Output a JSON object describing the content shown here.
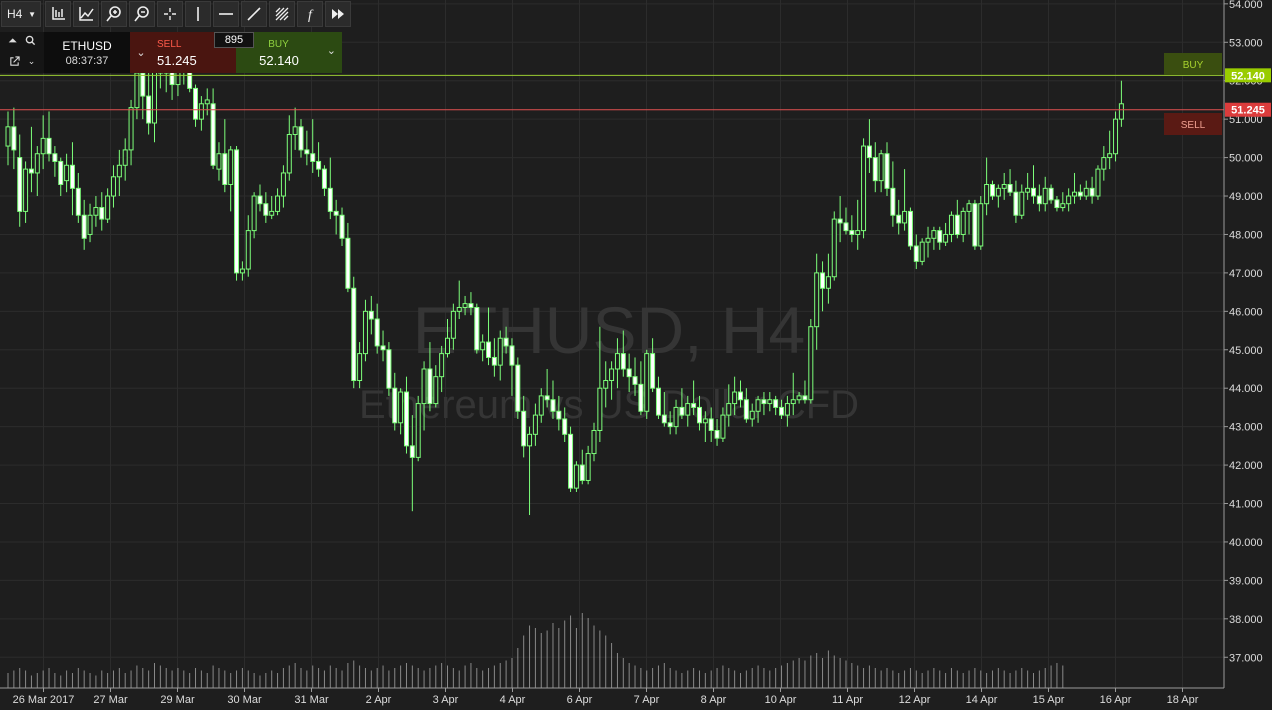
{
  "toolbar": {
    "timeframe": "H4",
    "tools": [
      "crosshair-chart-icon",
      "indicator-icon",
      "zoom-in-icon",
      "zoom-out-icon",
      "cursor-cross-icon",
      "vertical-line-icon",
      "horizontal-line-icon",
      "trend-line-icon",
      "fibonacci-icon",
      "function-icon",
      "fast-forward-icon"
    ]
  },
  "trade_panel": {
    "symbol": "ETHUSD",
    "countdown": "08:37:37",
    "sell_label": "SELL",
    "sell_price": "51.245",
    "spread": "895",
    "buy_label": "BUY",
    "buy_price": "52.140"
  },
  "colors": {
    "background": "#1e1e1e",
    "grid": "#2c2c2c",
    "candle": "#7dff7a",
    "volume": "#cfcfcf",
    "buy_line": "#9acd32",
    "sell_line": "#e05050",
    "buy_tag": "#99cc00",
    "sell_tag": "#dc3c3c"
  },
  "chart_data": {
    "type": "candlestick",
    "symbol": "ETHUSD",
    "timeframe": "H4",
    "watermark_title": "ETHUSD, H4",
    "watermark_subtitle": "Ethereum vs US Dollar CFD",
    "ylim": [
      36.2,
      54.1
    ],
    "y_ticks": [
      "54.000",
      "53.000",
      "52.000",
      "51.000",
      "50.000",
      "49.000",
      "48.000",
      "47.000",
      "46.000",
      "45.000",
      "44.000",
      "43.000",
      "42.000",
      "41.000",
      "40.000",
      "39.000",
      "38.000",
      "37.000"
    ],
    "x_labels": [
      "26 Mar 2017",
      "27 Mar",
      "29 Mar",
      "30 Mar",
      "31 Mar",
      "2 Apr",
      "3 Apr",
      "4 Apr",
      "6 Apr",
      "7 Apr",
      "8 Apr",
      "10 Apr",
      "11 Apr",
      "12 Apr",
      "14 Apr",
      "15 Apr",
      "16 Apr",
      "18 Apr"
    ],
    "buy_price": 52.14,
    "sell_price": 51.245,
    "buy_tag": "52.140",
    "sell_tag": "51.245",
    "buy_label": "BUY",
    "sell_label": "SELL",
    "candles": [
      [
        50.3,
        51.2,
        49.8,
        50.8
      ],
      [
        50.8,
        51.3,
        49.7,
        50.2
      ],
      [
        50.0,
        50.6,
        48.2,
        48.6
      ],
      [
        48.6,
        49.9,
        48.3,
        49.7
      ],
      [
        49.7,
        50.8,
        49.1,
        49.6
      ],
      [
        49.6,
        50.3,
        49.0,
        50.1
      ],
      [
        50.1,
        51.1,
        49.7,
        50.5
      ],
      [
        50.5,
        51.2,
        49.9,
        50.1
      ],
      [
        50.1,
        50.3,
        49.5,
        49.9
      ],
      [
        49.9,
        50.0,
        49.0,
        49.3
      ],
      [
        49.4,
        50.1,
        49.1,
        49.8
      ],
      [
        49.8,
        50.4,
        48.5,
        49.2
      ],
      [
        49.2,
        49.6,
        48.3,
        48.5
      ],
      [
        48.5,
        48.9,
        47.6,
        47.9
      ],
      [
        48.0,
        48.8,
        47.8,
        48.5
      ],
      [
        48.5,
        49.0,
        48.2,
        48.7
      ],
      [
        48.7,
        49.1,
        48.1,
        48.4
      ],
      [
        48.4,
        49.2,
        48.3,
        49.0
      ],
      [
        49.0,
        49.8,
        48.7,
        49.5
      ],
      [
        49.5,
        50.2,
        49.0,
        49.8
      ],
      [
        49.8,
        50.5,
        49.4,
        50.2
      ],
      [
        50.2,
        51.5,
        49.8,
        51.3
      ],
      [
        51.3,
        52.5,
        51.0,
        52.2
      ],
      [
        52.2,
        52.6,
        51.0,
        51.6
      ],
      [
        51.6,
        52.5,
        50.6,
        50.9
      ],
      [
        50.9,
        52.9,
        50.4,
        52.6
      ],
      [
        52.6,
        53.2,
        51.8,
        52.2
      ],
      [
        52.2,
        52.9,
        51.7,
        52.3
      ],
      [
        52.3,
        52.6,
        51.5,
        51.9
      ],
      [
        51.9,
        52.7,
        51.6,
        52.3
      ],
      [
        52.3,
        52.9,
        51.9,
        52.6
      ],
      [
        52.6,
        53.0,
        51.7,
        51.8
      ],
      [
        51.8,
        51.9,
        50.8,
        51.0
      ],
      [
        51.0,
        51.6,
        50.7,
        51.4
      ],
      [
        51.4,
        51.8,
        51.1,
        51.5
      ],
      [
        51.4,
        51.8,
        49.7,
        49.8
      ],
      [
        49.7,
        50.4,
        49.4,
        50.1
      ],
      [
        50.1,
        51.0,
        49.1,
        49.3
      ],
      [
        49.3,
        50.3,
        48.6,
        50.2
      ],
      [
        50.2,
        50.3,
        46.8,
        47.0
      ],
      [
        47.0,
        47.3,
        46.8,
        47.1
      ],
      [
        47.1,
        48.5,
        46.9,
        48.1
      ],
      [
        48.1,
        49.1,
        47.9,
        49.0
      ],
      [
        49.0,
        49.3,
        48.6,
        48.8
      ],
      [
        48.8,
        49.1,
        48.3,
        48.5
      ],
      [
        48.5,
        49.0,
        48.4,
        48.6
      ],
      [
        48.6,
        49.2,
        48.5,
        49.0
      ],
      [
        49.0,
        49.8,
        48.7,
        49.6
      ],
      [
        49.6,
        51.1,
        49.4,
        50.6
      ],
      [
        50.6,
        51.3,
        50.2,
        50.8
      ],
      [
        50.8,
        51.0,
        50.0,
        50.2
      ],
      [
        50.2,
        50.7,
        49.8,
        50.1
      ],
      [
        50.1,
        51.0,
        49.6,
        49.9
      ],
      [
        49.9,
        50.4,
        49.5,
        49.7
      ],
      [
        49.7,
        49.8,
        49.0,
        49.2
      ],
      [
        49.2,
        50.0,
        48.4,
        48.6
      ],
      [
        48.6,
        48.9,
        48.0,
        48.5
      ],
      [
        48.5,
        48.7,
        47.7,
        47.9
      ],
      [
        47.9,
        48.3,
        46.5,
        46.6
      ],
      [
        46.6,
        46.9,
        44.0,
        44.2
      ],
      [
        44.2,
        45.2,
        44.0,
        44.9
      ],
      [
        44.9,
        46.3,
        44.7,
        46.0
      ],
      [
        46.0,
        46.4,
        45.4,
        45.8
      ],
      [
        45.8,
        46.2,
        44.9,
        45.1
      ],
      [
        45.1,
        45.5,
        44.7,
        45.0
      ],
      [
        45.0,
        45.2,
        43.8,
        44.0
      ],
      [
        44.0,
        44.4,
        42.9,
        43.1
      ],
      [
        43.1,
        44.0,
        42.8,
        43.9
      ],
      [
        43.9,
        44.3,
        42.3,
        42.5
      ],
      [
        42.5,
        43.3,
        40.8,
        42.2
      ],
      [
        42.2,
        43.8,
        42.1,
        43.6
      ],
      [
        43.6,
        44.7,
        42.9,
        44.5
      ],
      [
        44.5,
        45.2,
        43.4,
        43.6
      ],
      [
        43.6,
        44.6,
        43.5,
        44.3
      ],
      [
        44.3,
        45.1,
        43.9,
        44.9
      ],
      [
        44.9,
        45.8,
        44.8,
        45.3
      ],
      [
        45.3,
        46.2,
        45.0,
        46.0
      ],
      [
        46.0,
        46.8,
        45.8,
        46.1
      ],
      [
        46.1,
        46.4,
        45.9,
        46.2
      ],
      [
        46.2,
        46.5,
        45.9,
        46.1
      ],
      [
        46.1,
        46.2,
        44.9,
        45.0
      ],
      [
        45.0,
        45.4,
        44.7,
        45.2
      ],
      [
        45.2,
        46.1,
        44.6,
        44.8
      ],
      [
        44.8,
        45.3,
        44.3,
        44.6
      ],
      [
        44.6,
        45.5,
        44.2,
        45.3
      ],
      [
        45.3,
        45.6,
        44.9,
        45.1
      ],
      [
        45.1,
        45.3,
        43.8,
        44.6
      ],
      [
        44.6,
        44.8,
        43.2,
        43.4
      ],
      [
        43.4,
        43.8,
        42.2,
        42.5
      ],
      [
        42.5,
        43.0,
        40.7,
        42.8
      ],
      [
        42.8,
        43.6,
        42.5,
        43.3
      ],
      [
        43.3,
        44.0,
        43.1,
        43.8
      ],
      [
        43.8,
        44.5,
        43.5,
        43.7
      ],
      [
        43.7,
        44.2,
        43.2,
        43.4
      ],
      [
        43.4,
        43.8,
        42.9,
        43.2
      ],
      [
        43.2,
        43.5,
        42.6,
        42.8
      ],
      [
        42.8,
        43.0,
        41.3,
        41.4
      ],
      [
        41.4,
        42.1,
        41.3,
        42.0
      ],
      [
        42.0,
        42.4,
        41.5,
        41.6
      ],
      [
        41.6,
        42.5,
        41.5,
        42.3
      ],
      [
        42.3,
        43.1,
        42.1,
        42.9
      ],
      [
        42.9,
        45.6,
        42.6,
        44.0
      ],
      [
        44.0,
        44.7,
        43.5,
        44.2
      ],
      [
        44.2,
        44.7,
        43.7,
        44.5
      ],
      [
        44.5,
        45.3,
        44.0,
        44.9
      ],
      [
        44.9,
        45.5,
        44.3,
        44.5
      ],
      [
        44.5,
        44.9,
        43.9,
        44.3
      ],
      [
        44.3,
        44.8,
        43.8,
        44.1
      ],
      [
        44.1,
        44.7,
        43.3,
        43.4
      ],
      [
        43.4,
        45.0,
        43.2,
        44.9
      ],
      [
        44.9,
        45.3,
        43.9,
        44.0
      ],
      [
        44.0,
        44.3,
        43.2,
        43.3
      ],
      [
        43.3,
        43.9,
        43.0,
        43.1
      ],
      [
        43.1,
        43.4,
        42.8,
        43.0
      ],
      [
        43.0,
        43.7,
        42.8,
        43.5
      ],
      [
        43.5,
        44.0,
        43.2,
        43.3
      ],
      [
        43.3,
        43.8,
        43.0,
        43.6
      ],
      [
        43.6,
        44.2,
        43.3,
        43.5
      ],
      [
        43.5,
        43.8,
        42.9,
        43.1
      ],
      [
        43.1,
        43.4,
        42.6,
        43.2
      ],
      [
        43.2,
        43.5,
        42.6,
        42.9
      ],
      [
        42.9,
        43.2,
        42.5,
        42.7
      ],
      [
        42.7,
        43.5,
        42.6,
        43.3
      ],
      [
        43.3,
        44.1,
        43.0,
        43.6
      ],
      [
        43.6,
        44.3,
        43.3,
        43.9
      ],
      [
        43.9,
        44.2,
        43.5,
        43.7
      ],
      [
        43.7,
        44.0,
        43.1,
        43.2
      ],
      [
        43.2,
        43.6,
        43.0,
        43.4
      ],
      [
        43.4,
        43.8,
        43.1,
        43.7
      ],
      [
        43.7,
        43.9,
        43.3,
        43.6
      ],
      [
        43.6,
        43.9,
        43.4,
        43.7
      ],
      [
        43.7,
        43.8,
        43.3,
        43.5
      ],
      [
        43.5,
        43.7,
        43.2,
        43.3
      ],
      [
        43.3,
        43.8,
        43.0,
        43.6
      ],
      [
        43.6,
        44.4,
        43.3,
        43.7
      ],
      [
        43.7,
        43.9,
        43.6,
        43.8
      ],
      [
        43.8,
        44.2,
        43.6,
        43.7
      ],
      [
        43.7,
        45.8,
        43.6,
        45.6
      ],
      [
        45.6,
        47.5,
        45.0,
        47.0
      ],
      [
        47.0,
        47.3,
        46.0,
        46.6
      ],
      [
        46.6,
        47.5,
        46.2,
        46.9
      ],
      [
        46.9,
        48.6,
        46.8,
        48.4
      ],
      [
        48.4,
        49.0,
        47.8,
        48.3
      ],
      [
        48.3,
        48.7,
        48.0,
        48.1
      ],
      [
        48.1,
        48.5,
        47.8,
        48.0
      ],
      [
        48.0,
        48.9,
        47.6,
        48.1
      ],
      [
        48.1,
        50.5,
        47.9,
        50.3
      ],
      [
        50.3,
        51.0,
        49.6,
        50.0
      ],
      [
        50.0,
        50.4,
        49.1,
        49.4
      ],
      [
        49.4,
        50.2,
        49.1,
        50.1
      ],
      [
        50.1,
        50.4,
        49.0,
        49.2
      ],
      [
        49.2,
        49.9,
        48.2,
        48.5
      ],
      [
        48.5,
        48.9,
        48.0,
        48.3
      ],
      [
        48.3,
        49.7,
        48.1,
        48.6
      ],
      [
        48.6,
        48.7,
        47.6,
        47.7
      ],
      [
        47.7,
        48.0,
        47.1,
        47.3
      ],
      [
        47.3,
        47.9,
        47.2,
        47.8
      ],
      [
        47.8,
        48.2,
        47.4,
        47.9
      ],
      [
        47.9,
        48.2,
        47.6,
        48.1
      ],
      [
        48.1,
        48.2,
        47.6,
        47.8
      ],
      [
        47.8,
        48.3,
        47.7,
        48.0
      ],
      [
        48.0,
        48.6,
        47.8,
        48.5
      ],
      [
        48.5,
        48.9,
        47.9,
        48.0
      ],
      [
        48.0,
        48.7,
        47.8,
        48.6
      ],
      [
        48.6,
        48.9,
        48.0,
        48.8
      ],
      [
        48.8,
        48.9,
        47.6,
        47.7
      ],
      [
        47.7,
        49.0,
        47.6,
        48.8
      ],
      [
        48.8,
        50.0,
        48.5,
        49.3
      ],
      [
        49.3,
        49.4,
        48.9,
        49.0
      ],
      [
        49.0,
        49.3,
        48.7,
        49.2
      ],
      [
        49.2,
        49.6,
        48.9,
        49.3
      ],
      [
        49.3,
        49.7,
        49.0,
        49.1
      ],
      [
        49.1,
        49.4,
        48.3,
        48.5
      ],
      [
        48.5,
        49.3,
        48.4,
        49.1
      ],
      [
        49.1,
        49.6,
        48.9,
        49.2
      ],
      [
        49.2,
        49.8,
        48.8,
        49.0
      ],
      [
        49.0,
        49.3,
        48.6,
        48.8
      ],
      [
        48.8,
        49.5,
        48.6,
        49.2
      ],
      [
        49.2,
        49.3,
        48.8,
        48.9
      ],
      [
        48.9,
        49.0,
        48.6,
        48.7
      ],
      [
        48.7,
        49.1,
        48.6,
        48.8
      ],
      [
        48.8,
        49.2,
        48.6,
        49.0
      ],
      [
        49.0,
        49.6,
        48.8,
        49.1
      ],
      [
        49.1,
        49.3,
        48.9,
        49.0
      ],
      [
        49.0,
        49.4,
        48.9,
        49.2
      ],
      [
        49.2,
        49.5,
        48.8,
        49.0
      ],
      [
        49.0,
        49.8,
        48.9,
        49.7
      ],
      [
        49.7,
        50.3,
        49.4,
        50.0
      ],
      [
        50.0,
        50.7,
        49.7,
        50.1
      ],
      [
        50.1,
        51.2,
        49.9,
        51.0
      ],
      [
        51.0,
        52.0,
        50.8,
        51.4
      ]
    ],
    "volumes": [
      6,
      7,
      8,
      7,
      5,
      6,
      7,
      8,
      6,
      5,
      7,
      6,
      8,
      7,
      6,
      5,
      7,
      6,
      7,
      8,
      6,
      7,
      9,
      8,
      7,
      10,
      9,
      8,
      7,
      8,
      7,
      6,
      8,
      7,
      6,
      9,
      8,
      7,
      6,
      7,
      8,
      7,
      6,
      5,
      6,
      7,
      6,
      8,
      9,
      10,
      8,
      7,
      9,
      8,
      7,
      9,
      8,
      7,
      10,
      11,
      9,
      8,
      7,
      8,
      9,
      7,
      8,
      9,
      10,
      9,
      8,
      7,
      8,
      9,
      10,
      9,
      8,
      7,
      9,
      10,
      8,
      7,
      8,
      9,
      10,
      11,
      12,
      16,
      21,
      25,
      24,
      22,
      23,
      26,
      24,
      27,
      29,
      24,
      30,
      28,
      25,
      23,
      21,
      18,
      14,
      12,
      10,
      9,
      8,
      7,
      8,
      9,
      10,
      8,
      7,
      6,
      7,
      8,
      7,
      6,
      7,
      8,
      9,
      8,
      7,
      6,
      7,
      8,
      9,
      8,
      7,
      8,
      9,
      10,
      11,
      12,
      11,
      13,
      14,
      12,
      15,
      13,
      12,
      11,
      10,
      9,
      8,
      9,
      8,
      7,
      8,
      7,
      6,
      7,
      8,
      7,
      6,
      7,
      8,
      7,
      6,
      8,
      7,
      6,
      7,
      8,
      7,
      6,
      7,
      8,
      7,
      6,
      7,
      8,
      7,
      6,
      7,
      8,
      9,
      10,
      9
    ]
  }
}
